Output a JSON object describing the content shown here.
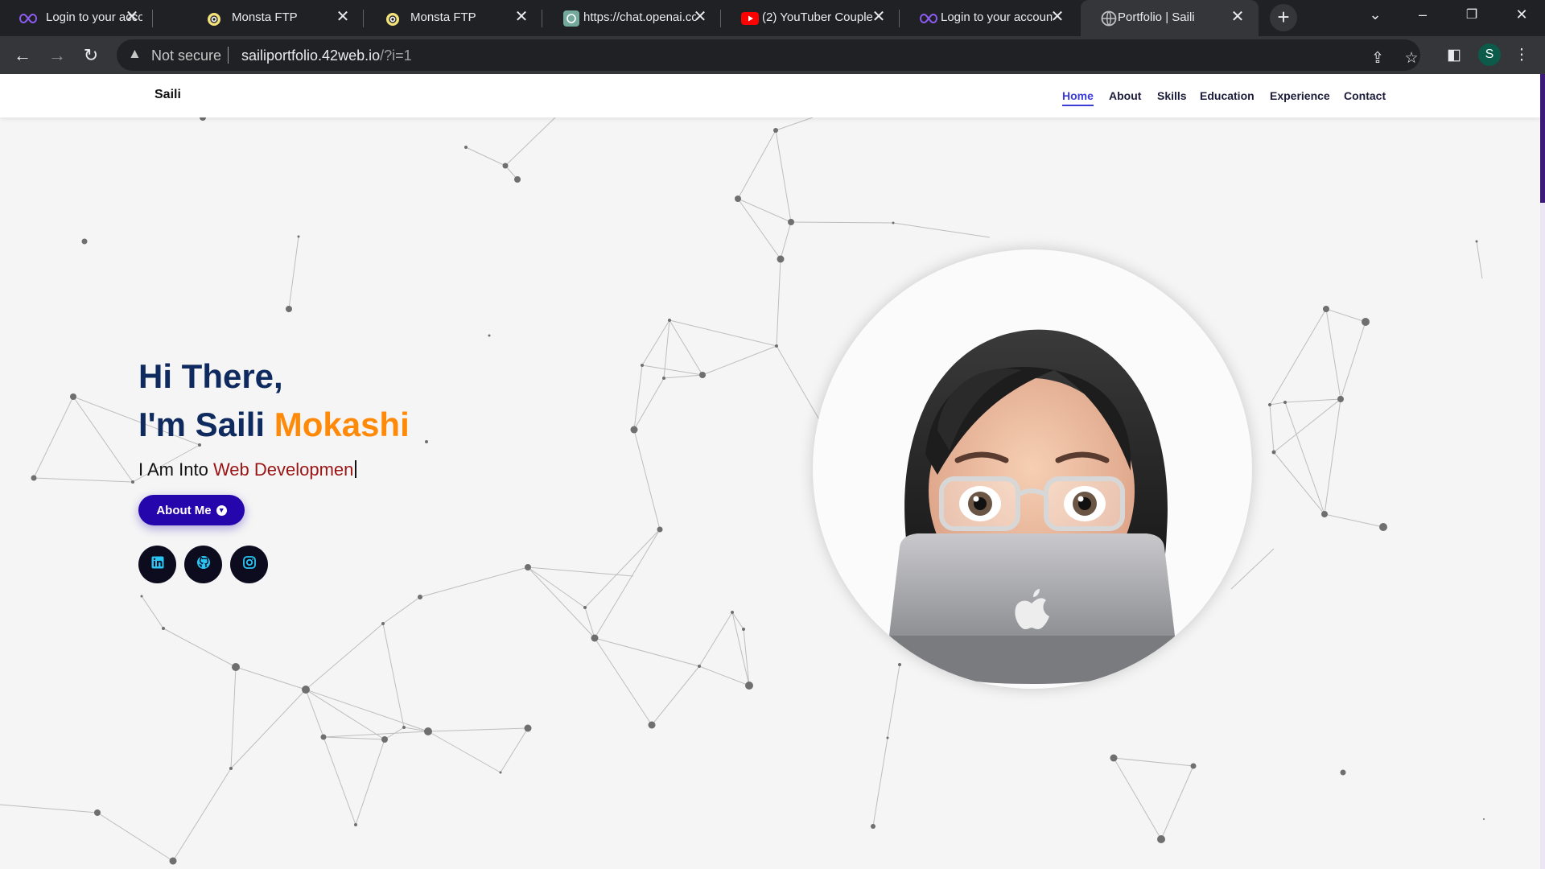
{
  "browser": {
    "tabs": [
      {
        "title": "Login to your account",
        "icon": "infinity-icon"
      },
      {
        "title": "Monsta FTP",
        "icon": "monsta-icon"
      },
      {
        "title": "Monsta FTP",
        "icon": "monsta-icon"
      },
      {
        "title": "https://chat.openai.com",
        "icon": "openai-icon"
      },
      {
        "title": "(2) YouTuber Couple",
        "icon": "youtube-icon"
      },
      {
        "title": "Login to your account",
        "icon": "infinity-icon"
      },
      {
        "title": "Portfolio | Saili",
        "icon": "globe-icon",
        "active": true
      }
    ],
    "security_label": "Not secure",
    "url_host": "sailiportfolio.42web.io",
    "url_path": "/?i=1",
    "profile_initial": "S"
  },
  "site": {
    "logo": "Saili",
    "nav": [
      "Home",
      "About",
      "Skills",
      "Education",
      "Experience",
      "Contact"
    ],
    "active_nav": "Home",
    "hero": {
      "greeting": "Hi There,",
      "name_prefix": "I'm Saili ",
      "name_accent": "Mokashi",
      "sub_prefix": "I Am Into ",
      "sub_typed": "Web Developmen",
      "button_label": "About Me"
    },
    "socials": [
      "linkedin-icon",
      "github-icon",
      "instagram-icon"
    ],
    "colors": {
      "heading": "#0e2a5e",
      "accent": "#ff8a0a",
      "typed": "#9b1414",
      "button": "#2506ad",
      "nav_active": "#3b3bd6"
    }
  }
}
